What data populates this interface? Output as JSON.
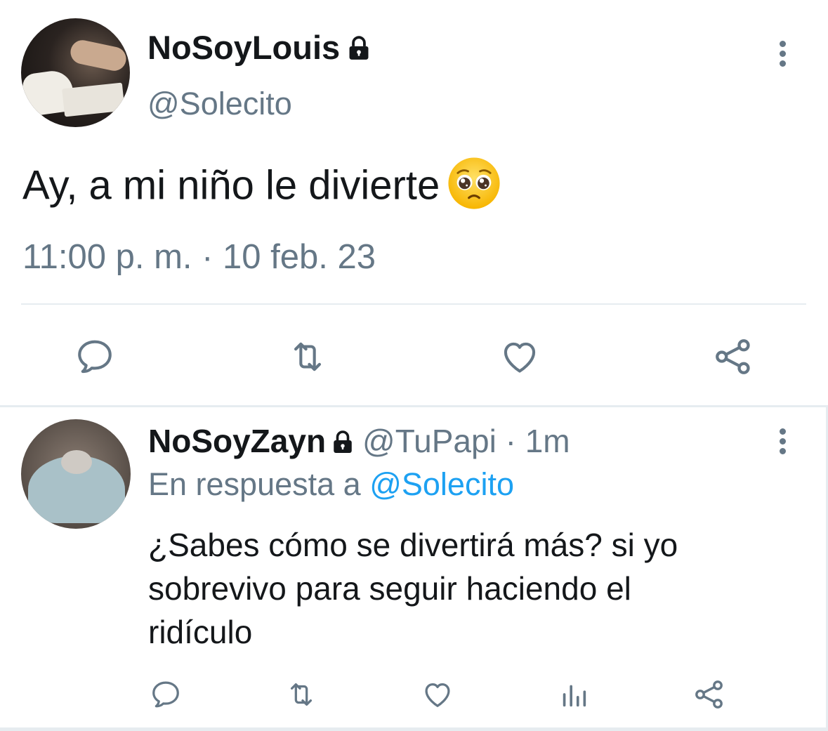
{
  "main_tweet": {
    "display_name": "NoSoyLouis",
    "handle": "@Solecito",
    "text": "Ay, a mi niño le divierte",
    "emoji": "pleading-face-emoji",
    "timestamp": "11:00 p. m. · 10 feb. 23",
    "actions": [
      "reply-icon",
      "retweet-icon",
      "like-icon",
      "share-icon"
    ]
  },
  "reply_tweet": {
    "display_name": "NoSoyZayn",
    "handle": "@TuPapi",
    "separator": " · ",
    "time": "1m",
    "reply_prefix": "En respuesta a ",
    "reply_mention": "@Solecito",
    "text_lines": [
      "¿Sabes cómo se divertirá más? si yo",
      "sobrevivo para seguir haciendo el",
      "ridículo"
    ],
    "actions": [
      "reply-icon",
      "retweet-icon",
      "like-icon",
      "analytics-icon",
      "share-icon"
    ]
  },
  "colors": {
    "text": "#14171a",
    "secondary": "#657786",
    "link": "#1da1f2",
    "divider": "#e6ecf0"
  }
}
